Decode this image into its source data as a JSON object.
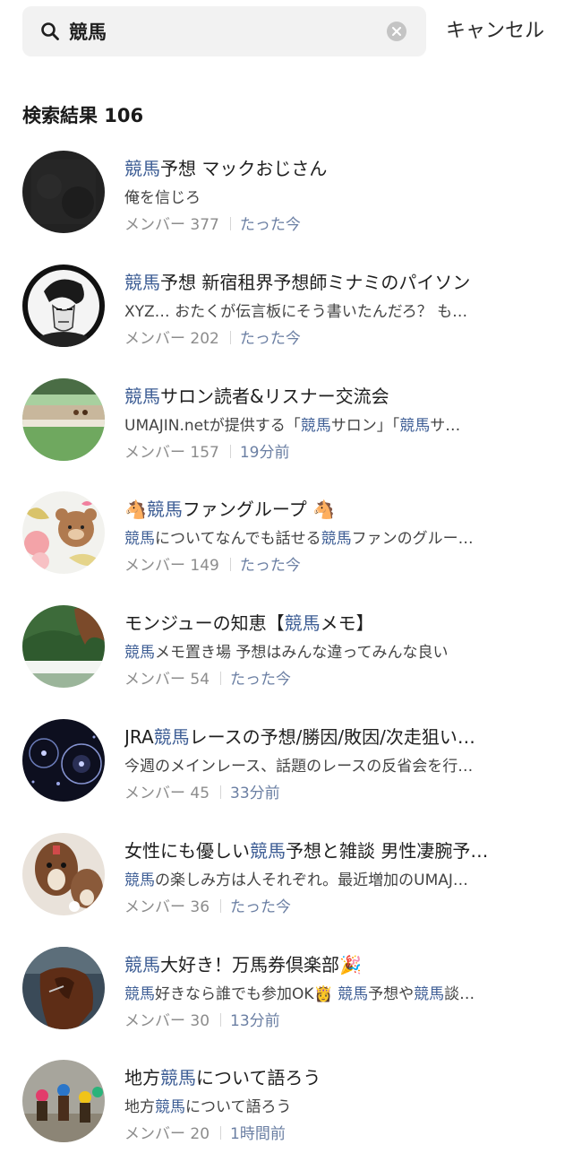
{
  "search": {
    "query": "競馬",
    "cancel_label": "キャンセル"
  },
  "results_header": "検索結果 106",
  "results": [
    {
      "title": [
        {
          "t": "競馬",
          "h": true
        },
        {
          "t": "予想 マックおじさん",
          "h": false
        }
      ],
      "desc": [
        {
          "t": "俺を信じろ",
          "h": false
        }
      ],
      "members": "メンバー 377",
      "time": "たった今",
      "avatar_icon": "dark-texture-avatar"
    },
    {
      "title": [
        {
          "t": "競馬",
          "h": true
        },
        {
          "t": "予想 新宿租界予想師ミナミのパイソン",
          "h": false
        }
      ],
      "desc": [
        {
          "t": "XYZ… おたくが伝言板にそう書いたんだろ？ も…",
          "h": false
        }
      ],
      "members": "メンバー 202",
      "time": "たった今",
      "avatar_icon": "manga-face-avatar"
    },
    {
      "title": [
        {
          "t": "競馬",
          "h": true
        },
        {
          "t": "サロン読者&リスナー交流会",
          "h": false
        }
      ],
      "desc": [
        {
          "t": "UMAJIN.netが提供する「",
          "h": false
        },
        {
          "t": "競馬",
          "h": true
        },
        {
          "t": "サロン」「",
          "h": false
        },
        {
          "t": "競馬",
          "h": true
        },
        {
          "t": "サ…",
          "h": false
        }
      ],
      "members": "メンバー 157",
      "time": "19分前",
      "avatar_icon": "racetrack-avatar"
    },
    {
      "title": [
        {
          "t": "🐴",
          "h": false
        },
        {
          "t": "競馬",
          "h": true
        },
        {
          "t": "ファングループ 🐴",
          "h": false
        }
      ],
      "desc": [
        {
          "t": "競馬",
          "h": true
        },
        {
          "t": "についてなんでも話せる",
          "h": false
        },
        {
          "t": "競馬",
          "h": true
        },
        {
          "t": "ファンのグルー…",
          "h": false
        }
      ],
      "members": "メンバー 149",
      "time": "たった今",
      "avatar_icon": "bear-character-avatar"
    },
    {
      "title": [
        {
          "t": "モンジューの知恵【",
          "h": false
        },
        {
          "t": "競馬",
          "h": true
        },
        {
          "t": "メモ】",
          "h": false
        }
      ],
      "desc": [
        {
          "t": "競馬",
          "h": true
        },
        {
          "t": "メモ置き場 予想はみんな違ってみんな良い",
          "h": false
        }
      ],
      "members": "メンバー 54",
      "time": "たった今",
      "avatar_icon": "horse-field-avatar"
    },
    {
      "title": [
        {
          "t": "JRA",
          "h": false
        },
        {
          "t": "競馬",
          "h": true
        },
        {
          "t": "レースの予想/勝因/敗因/次走狙い…",
          "h": false
        }
      ],
      "desc": [
        {
          "t": "今週のメインレース、話題のレースの反省会を行…",
          "h": false
        }
      ],
      "members": "メンバー 45",
      "time": "33分前",
      "avatar_icon": "night-lights-avatar"
    },
    {
      "title": [
        {
          "t": "女性にも優しい",
          "h": false
        },
        {
          "t": "競馬",
          "h": true
        },
        {
          "t": "予想と雑談 男性凄腕予…",
          "h": false
        }
      ],
      "desc": [
        {
          "t": "競馬",
          "h": true
        },
        {
          "t": "の楽しみ方は人それぞれ。最近増加のUMAJ…",
          "h": false
        }
      ],
      "members": "メンバー 36",
      "time": "たった今",
      "avatar_icon": "horse-plush-avatar"
    },
    {
      "title": [
        {
          "t": "競馬",
          "h": true
        },
        {
          "t": "大好き！万馬券倶楽部🎉",
          "h": false
        }
      ],
      "desc": [
        {
          "t": "競馬",
          "h": true
        },
        {
          "t": "好きなら誰でも参加OK👸 ",
          "h": false
        },
        {
          "t": "競馬",
          "h": true
        },
        {
          "t": "予想や",
          "h": false
        },
        {
          "t": "競馬",
          "h": true
        },
        {
          "t": "談…",
          "h": false
        }
      ],
      "members": "メンバー 30",
      "time": "13分前",
      "avatar_icon": "racehorse-avatar"
    },
    {
      "title": [
        {
          "t": "地方",
          "h": false
        },
        {
          "t": "競馬",
          "h": true
        },
        {
          "t": "について語ろう",
          "h": false
        }
      ],
      "desc": [
        {
          "t": "地方",
          "h": false
        },
        {
          "t": "競馬",
          "h": true
        },
        {
          "t": "について語ろう",
          "h": false
        }
      ],
      "members": "メンバー 20",
      "time": "1時間前",
      "avatar_icon": "jockeys-race-avatar"
    }
  ],
  "colors": {
    "highlight": "#3e5e95",
    "meta": "#8c8c8c",
    "recency": "#6b7fa3",
    "search_bg": "#f2f2f2"
  }
}
